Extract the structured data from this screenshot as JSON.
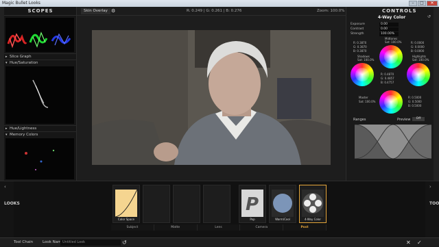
{
  "window": {
    "title": "Magic Bullet Looks",
    "min": "–",
    "max": "□",
    "close": "✕"
  },
  "left_panel": {
    "header": "SCOPES",
    "sections": [
      "Slice Graph",
      "Hue/Saturation",
      "Hue/Lightness",
      "Memory Colors"
    ]
  },
  "topbar": {
    "mode_button": "Skin Overlay",
    "gear": "⚙",
    "coords": "R: 0.249 | G: 0.261 | B: 0.276",
    "zoom": "Zoom: 100.0%"
  },
  "right_panel": {
    "header": "CONTROLS",
    "tool_name": "4-Way Color",
    "params": [
      {
        "label": "Exposure",
        "value": "0.00"
      },
      {
        "label": "Contrast",
        "value": "0.00"
      },
      {
        "label": "Strength",
        "value": "100.00%"
      }
    ],
    "wheels": {
      "shadows": {
        "label": "Shadows",
        "sat": "Sat: 100.0%",
        "r": "R: 0.3870",
        "g": "G: 0.3870",
        "b": "B: 0.3870"
      },
      "midtones": {
        "label": "Midtones",
        "sat": "Sat: 100.0%",
        "r": "R: 0.0000",
        "g": "G: 0.0000",
        "b": "B: 0.0000"
      },
      "highlights": {
        "label": "Highlights",
        "sat": "Sat: 100.0%",
        "r": "R: 0.5000",
        "g": "G: 0.5000",
        "b": "B: 0.5000"
      },
      "master": {
        "label": "Master",
        "sat": "Sat: 100.0%",
        "r": "R: 0.4870",
        "g": "G: 0.4857",
        "b": "B: 0.4757",
        "r2": "R: 0.5000",
        "g2": "G: 0.5000",
        "b2": "B: 0.5000"
      }
    },
    "ranges_label": "Ranges",
    "preview_label": "Preview",
    "preview_value": "Off"
  },
  "bottom": {
    "looks_label": "LOOKS",
    "tools_label": "TOOLS",
    "tiles": [
      {
        "name": "Color Space"
      },
      {
        "name": ""
      },
      {
        "name": ""
      },
      {
        "name": ""
      },
      {
        "name": "Pop"
      },
      {
        "name": "Warm/Cool"
      },
      {
        "name": "4-Way Color"
      }
    ],
    "categories": [
      "Subject",
      "Matte",
      "Lens",
      "Camera",
      "Post"
    ],
    "active_category": "Post"
  },
  "statusbar": {
    "tool_chain": "Tool Chain",
    "look_name_label": "Look Name:",
    "look_name_value": "Untitled Look",
    "reset_icon": "↺",
    "cancel_icon": "✕",
    "ok_icon": "✓"
  }
}
